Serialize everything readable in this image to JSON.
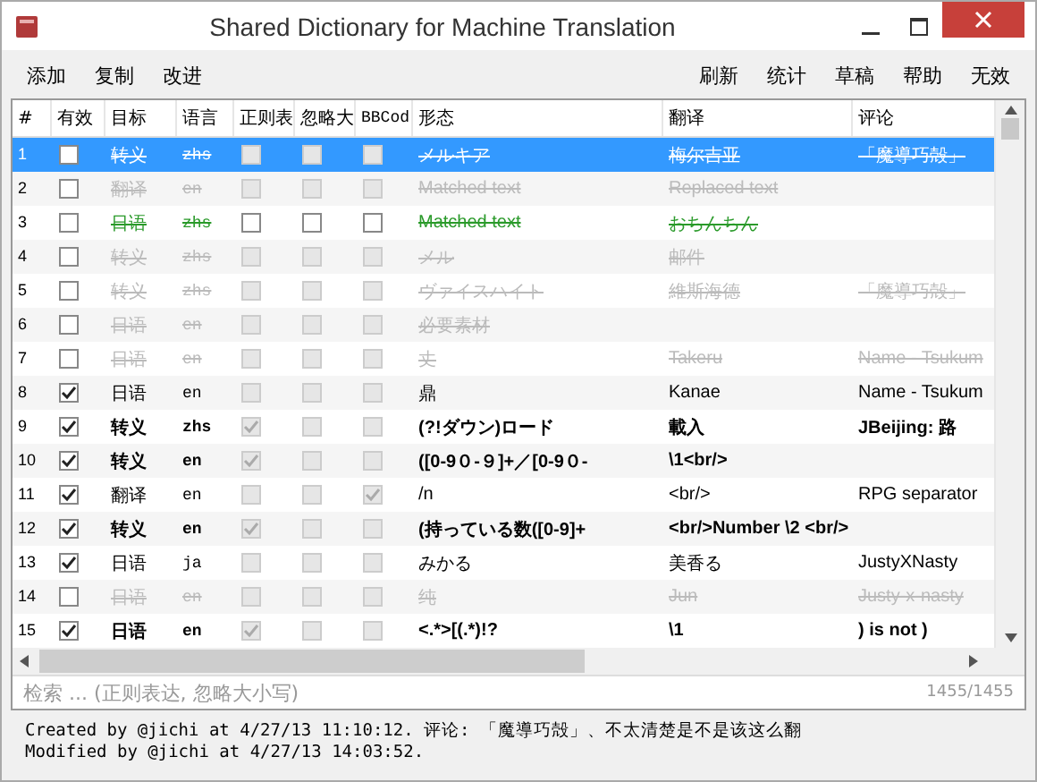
{
  "window": {
    "title": "Shared Dictionary for Machine Translation"
  },
  "toolbar": {
    "left": [
      "添加",
      "复制",
      "改进"
    ],
    "right": [
      "刷新",
      "统计",
      "草稿",
      "帮助",
      "无效"
    ]
  },
  "table": {
    "columns": [
      "#",
      "有效",
      "目标",
      "语言",
      "正则表",
      "忽略大",
      "BBCod",
      "形态",
      "翻译",
      "评论"
    ],
    "rows": [
      {
        "index": "1",
        "selected": true,
        "kind": "disabled",
        "bold": false,
        "enabled": false,
        "target": "转义",
        "language": "zhs",
        "regex": false,
        "ignore_case": false,
        "bbcode": false,
        "pattern": "メルキア",
        "translation": "梅尔吉亚",
        "comment": "「魔導巧殻」"
      },
      {
        "index": "2",
        "selected": false,
        "kind": "disabled",
        "bold": false,
        "enabled": false,
        "target": "翻译",
        "language": "en",
        "regex": false,
        "ignore_case": false,
        "bbcode": false,
        "pattern": "Matched text",
        "translation": "Replaced text"
      },
      {
        "index": "3",
        "selected": false,
        "kind": "new",
        "bold": false,
        "enabled": false,
        "target": "日语",
        "language": "zhs",
        "regex": false,
        "ignore_case": false,
        "bbcode": false,
        "pattern": "Matched text",
        "translation": "おちんちん"
      },
      {
        "index": "4",
        "selected": false,
        "kind": "disabled",
        "bold": false,
        "enabled": false,
        "target": "转义",
        "language": "zhs",
        "regex": false,
        "ignore_case": false,
        "bbcode": false,
        "pattern": "メル",
        "translation": "邮件"
      },
      {
        "index": "5",
        "selected": false,
        "kind": "disabled",
        "bold": false,
        "enabled": false,
        "target": "转义",
        "language": "zhs",
        "regex": false,
        "ignore_case": false,
        "bbcode": false,
        "pattern": "ヴァイスハイト",
        "translation": "維斯海德",
        "comment": "「魔導巧殻」"
      },
      {
        "index": "6",
        "selected": false,
        "kind": "disabled",
        "bold": false,
        "enabled": false,
        "target": "日语",
        "language": "en",
        "regex": false,
        "ignore_case": false,
        "bbcode": false,
        "pattern": "必要素材"
      },
      {
        "index": "7",
        "selected": false,
        "kind": "disabled",
        "bold": false,
        "enabled": false,
        "target": "日语",
        "language": "en",
        "regex": false,
        "ignore_case": false,
        "bbcode": false,
        "pattern": "丈",
        "translation": "Takeru",
        "comment": "Name - Tsukum"
      },
      {
        "index": "8",
        "selected": false,
        "kind": "active",
        "bold": false,
        "enabled": true,
        "target": "日语",
        "language": "en",
        "regex": false,
        "ignore_case": false,
        "bbcode": false,
        "pattern": "鼎",
        "translation": "Kanae",
        "comment": "Name - Tsukum"
      },
      {
        "index": "9",
        "selected": false,
        "kind": "active",
        "bold": true,
        "enabled": true,
        "target": "转义",
        "language": "zhs",
        "regex": true,
        "ignore_case": false,
        "bbcode": false,
        "pattern": "(?!ダウン)ロード",
        "translation": "載入",
        "comment": "JBeijing: 路"
      },
      {
        "index": "10",
        "selected": false,
        "kind": "active",
        "bold": true,
        "enabled": true,
        "target": "转义",
        "language": "en",
        "regex": true,
        "ignore_case": false,
        "bbcode": false,
        "pattern": "([0-9０-９]+／[0-9０-",
        "translation": "\\1<br/>"
      },
      {
        "index": "11",
        "selected": false,
        "kind": "active",
        "bold": false,
        "enabled": true,
        "target": "翻译",
        "language": "en",
        "regex": false,
        "ignore_case": false,
        "bbcode": true,
        "pattern": "/n",
        "translation": "<br/>",
        "comment": "RPG separator"
      },
      {
        "index": "12",
        "selected": false,
        "kind": "active",
        "bold": true,
        "enabled": true,
        "target": "转义",
        "language": "en",
        "regex": true,
        "ignore_case": false,
        "bbcode": false,
        "pattern": "(持っている数([0-9]+",
        "translation": "<br/>Number \\2 <br/>"
      },
      {
        "index": "13",
        "selected": false,
        "kind": "active",
        "bold": false,
        "enabled": true,
        "target": "日语",
        "language": "ja",
        "regex": false,
        "ignore_case": false,
        "bbcode": false,
        "pattern": "みかる",
        "translation": "美香る",
        "comment": "JustyXNasty"
      },
      {
        "index": "14",
        "selected": false,
        "kind": "disabled",
        "bold": false,
        "enabled": false,
        "target": "日语",
        "language": "en",
        "regex": false,
        "ignore_case": false,
        "bbcode": false,
        "pattern": "纯",
        "translation": "Jun",
        "comment": "Justy-x-nasty"
      },
      {
        "index": "15",
        "selected": false,
        "kind": "active",
        "bold": true,
        "enabled": true,
        "target": "日语",
        "language": "en",
        "regex": true,
        "ignore_case": false,
        "bbcode": false,
        "pattern": "<.*>[(.*)!?",
        "translation": "\\1",
        "comment": ") is not )"
      }
    ]
  },
  "search": {
    "placeholder": "检索 ... (正则表达, 忽略大小写)",
    "count": "1455/1455"
  },
  "status_bar": [
    "Created by @jichi at 4/27/13 11:10:12. 评论: 「魔導巧殻」、不太清楚是不是该这么翻",
    "Modified by @jichi at 4/27/13 14:03:52."
  ]
}
